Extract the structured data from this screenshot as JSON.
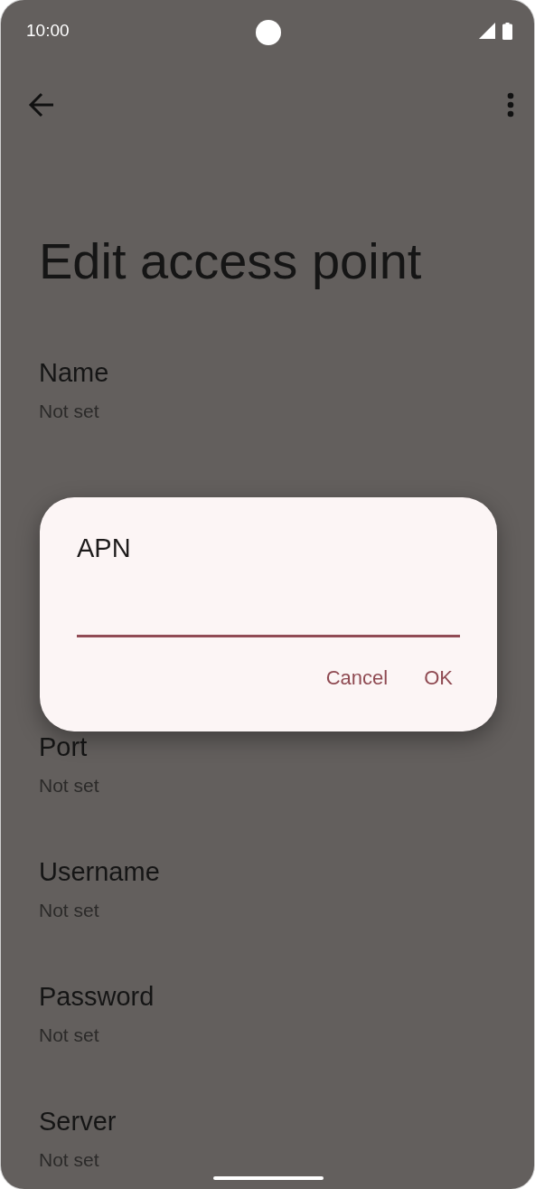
{
  "status_bar": {
    "time": "10:00"
  },
  "app_bar": {
    "title": "Edit access point"
  },
  "settings": [
    {
      "title": "Name",
      "summary": "Not set"
    },
    {
      "title": "Port",
      "summary": "Not set"
    },
    {
      "title": "Username",
      "summary": "Not set"
    },
    {
      "title": "Password",
      "summary": "Not set"
    },
    {
      "title": "Server",
      "summary": "Not set"
    }
  ],
  "dialog": {
    "title": "APN",
    "field": {
      "focused": true
    },
    "buttons": [
      "Cancel",
      "OK"
    ]
  }
}
